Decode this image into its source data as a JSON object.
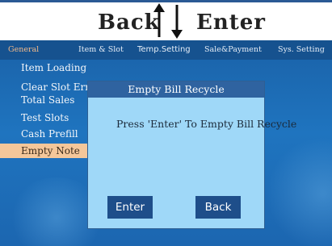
{
  "hints": {
    "back_label": "Back",
    "enter_label": "Enter"
  },
  "tabs": [
    {
      "label": "General",
      "active": true
    },
    {
      "label": "Item & Slot",
      "active": false
    },
    {
      "label": "Temp.Setting",
      "active": false
    },
    {
      "label": "Sale&Payment",
      "active": false
    },
    {
      "label": "Sys. Setting",
      "active": false
    }
  ],
  "menu": {
    "items": [
      {
        "label": "Item Loading"
      },
      {
        "label": "Clear Slot Error"
      },
      {
        "label": "Total Sales"
      },
      {
        "label": "Test Slots"
      },
      {
        "label": "Cash Prefill"
      },
      {
        "label": "Empty Note",
        "selected": true
      }
    ]
  },
  "dialog": {
    "title": "Empty Bill Recycle",
    "message": "Press 'Enter' To Empty Bill Recycle",
    "enter_label": "Enter",
    "back_label": "Back"
  },
  "colors": {
    "screen_bg": "#1f74bf",
    "tab_bar": "#16528f",
    "active_tab_text": "#f2b98a",
    "selected_item_bg": "#f4c79a",
    "dialog_bg": "#9fd8f8",
    "dialog_title_bg": "#2f63a0",
    "button_bg": "#1e4e8a"
  }
}
